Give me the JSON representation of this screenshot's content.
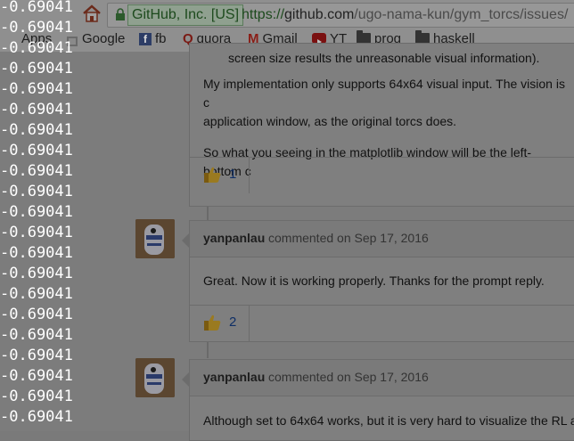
{
  "browser": {
    "secure_label": "GitHub, Inc. [US]",
    "url_https": "https://",
    "url_domain": "github.com",
    "url_path": "/ugo-nama-kun/gym_torcs/issues/",
    "bookmarks": [
      {
        "label": "Apps",
        "icon": "apps-grid-icon"
      },
      {
        "label": "Google",
        "icon": "google-icon"
      },
      {
        "label": "fb",
        "icon": "facebook-icon"
      },
      {
        "label": "quora",
        "icon": "quora-icon"
      },
      {
        "label": "Gmail",
        "icon": "gmail-icon"
      },
      {
        "label": "YT",
        "icon": "youtube-icon"
      },
      {
        "label": "prog",
        "icon": "folder-icon"
      },
      {
        "label": "haskell",
        "icon": "folder-icon"
      }
    ]
  },
  "comment1": {
    "text1": "screen size results the unreasonable visual information).",
    "text2a": "My implementation only supports 64x64 visual input. The vision is c",
    "text2b": "application window, as the original torcs does.",
    "text3": "So what you seeing in the matplotlib window will be the left-bottom c",
    "reaction_count": "1"
  },
  "comment2": {
    "author": "yanpanlau",
    "meta": "commented on Sep 17, 2016",
    "text": "Great. Now it is working properly. Thanks for the prompt reply.",
    "reaction_count": "2"
  },
  "comment3": {
    "author": "yanpanlau",
    "meta": "commented on Sep 17, 2016",
    "text": "Although set to 64x64 works, but it is very hard to visualize the RL a"
  },
  "terminal": {
    "lines": [
      "-0.69041",
      "-0.69041",
      "-0.69041",
      "-0.69041",
      "-0.69041",
      "-0.69041",
      "-0.69041",
      "-0.69041",
      "-0.69041",
      "-0.69041",
      "-0.69041",
      "-0.69041",
      "-0.69041",
      "-0.69041",
      "-0.69041",
      "-0.69041",
      "-0.69041",
      "-0.69041",
      "-0.69041",
      "-0.69041",
      "-0.69041"
    ]
  }
}
